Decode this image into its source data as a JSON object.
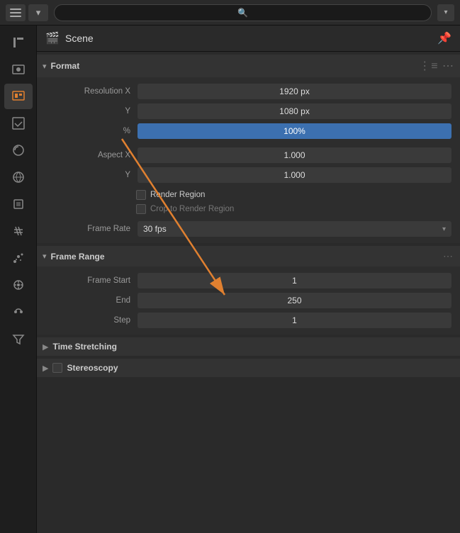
{
  "topbar": {
    "search_placeholder": "🔍",
    "chevron": "▾"
  },
  "sidebar": {
    "items": [
      {
        "id": "tools",
        "icon": "🔧",
        "active": false
      },
      {
        "id": "render",
        "icon": "📷",
        "active": false
      },
      {
        "id": "output",
        "icon": "🖨",
        "active": true
      },
      {
        "id": "view",
        "icon": "🖼",
        "active": false
      },
      {
        "id": "scene-settings",
        "icon": "🎨",
        "active": false
      },
      {
        "id": "world",
        "icon": "🌐",
        "active": false
      },
      {
        "id": "object",
        "icon": "📦",
        "active": false
      },
      {
        "id": "modifier",
        "icon": "🔩",
        "active": false
      },
      {
        "id": "particles",
        "icon": "✨",
        "active": false
      },
      {
        "id": "physics",
        "icon": "⚙",
        "active": false
      },
      {
        "id": "constraints",
        "icon": "🔗",
        "active": false
      },
      {
        "id": "filter",
        "icon": "🔽",
        "active": false
      }
    ]
  },
  "panel": {
    "icon": "🎬",
    "title": "Scene"
  },
  "format_section": {
    "label": "Format",
    "resolution_x_label": "Resolution X",
    "resolution_x_value": "1920 px",
    "resolution_y_label": "Y",
    "resolution_y_value": "1080 px",
    "resolution_pct_label": "%",
    "resolution_pct_value": "100%",
    "aspect_x_label": "Aspect X",
    "aspect_x_value": "1.000",
    "aspect_y_label": "Y",
    "aspect_y_value": "1.000",
    "render_region_label": "Render Region",
    "crop_label": "Crop to Render Region",
    "frame_rate_label": "Frame Rate",
    "frame_rate_value": "30 fps",
    "dots_icon": "⋮≡"
  },
  "frame_range_section": {
    "label": "Frame Range",
    "frame_start_label": "Frame Start",
    "frame_start_value": "1",
    "end_label": "End",
    "end_value": "250",
    "step_label": "Step",
    "step_value": "1",
    "dots_icon": "⋯"
  },
  "time_stretching": {
    "label": "Time Stretching"
  },
  "stereoscopy": {
    "label": "Stereoscopy"
  },
  "colors": {
    "accent_orange": "#e08030",
    "highlight_blue": "#3c70b0"
  }
}
